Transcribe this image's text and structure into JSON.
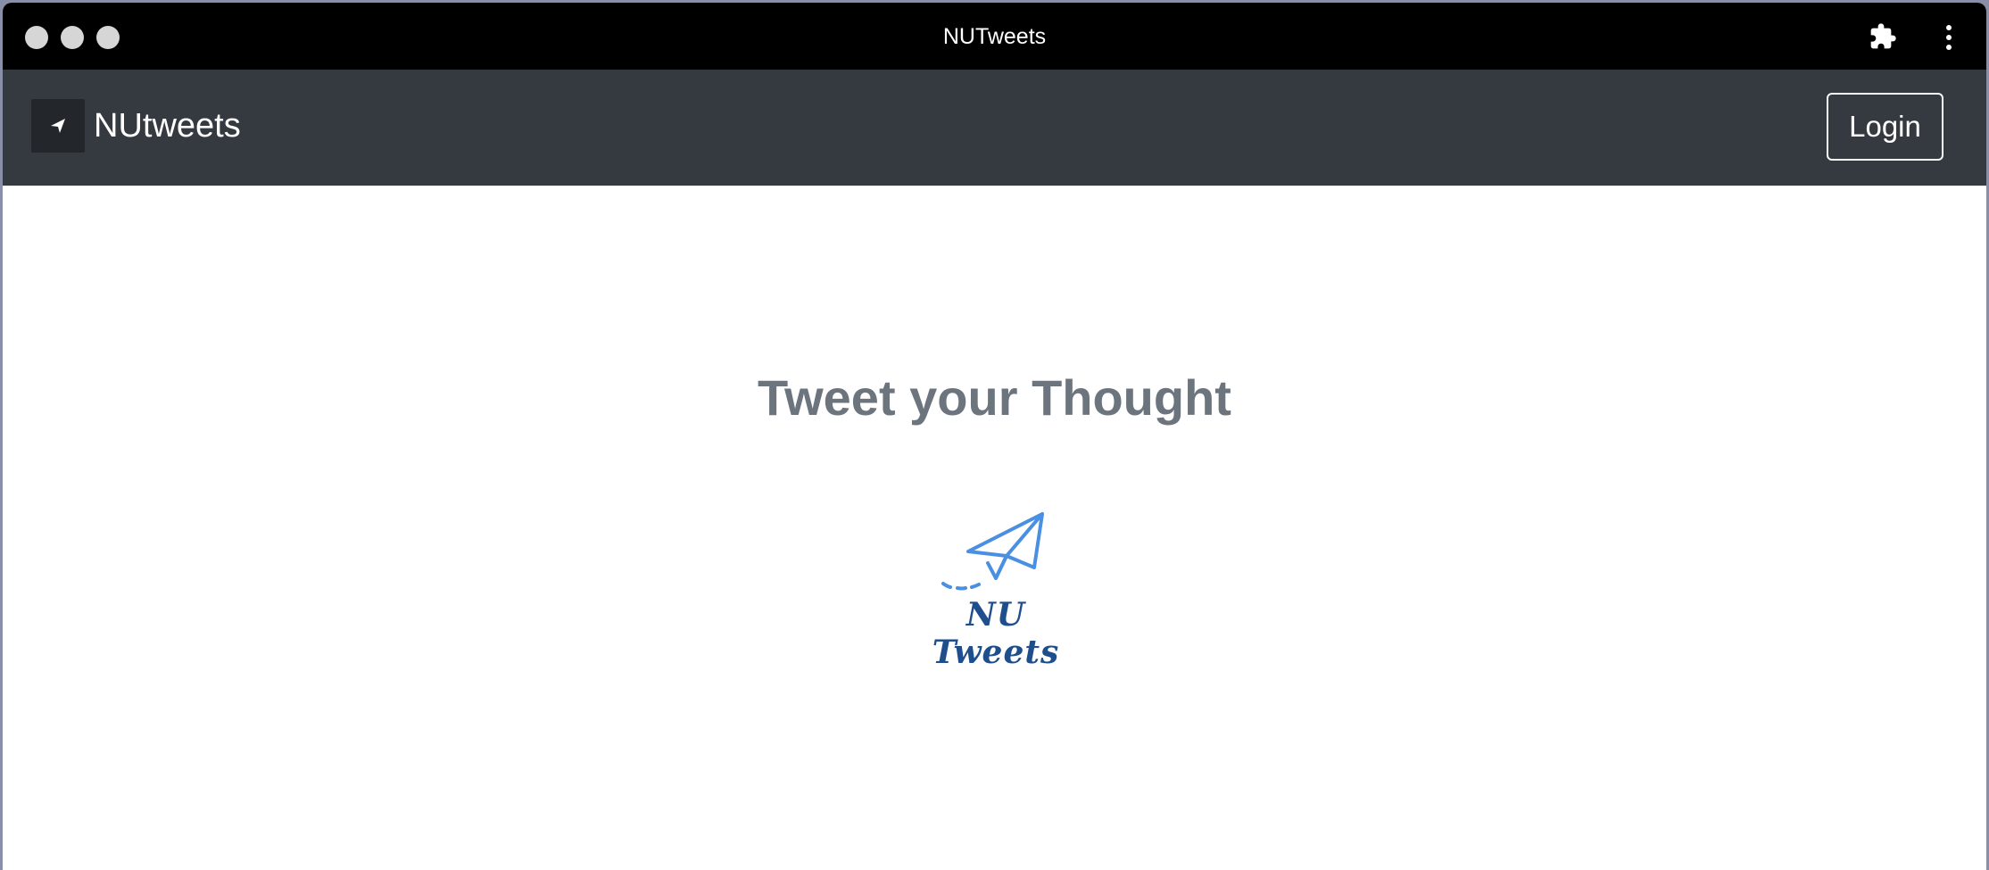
{
  "window": {
    "title": "NUTweets"
  },
  "navbar": {
    "brand": "NUtweets",
    "login_label": "Login"
  },
  "hero": {
    "title": "Tweet your Thought",
    "logo_text": "NU Tweets"
  },
  "colors": {
    "navbar_bg": "#343a40",
    "logo_blue": "#4a90e2",
    "logo_text_blue": "#1f4e8c",
    "title_gray": "#6c757d"
  }
}
